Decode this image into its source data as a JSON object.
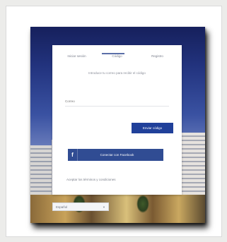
{
  "tabs": [
    {
      "label": "Iniciar sesión"
    },
    {
      "label": "Código"
    },
    {
      "label": "Registro"
    }
  ],
  "active_tab_index": 1,
  "subtitle": "Introduce tu correo para recibir el código",
  "email": {
    "placeholder": "Correo"
  },
  "submit_label": "Enviar código",
  "facebook": {
    "icon": "facebook-icon",
    "label": "Conectar con Facebook"
  },
  "terms_label": "Aceptar los términos y condiciones",
  "language": {
    "selected": "Español"
  },
  "colors": {
    "primary_button": "#20409a",
    "facebook_button": "#304c93",
    "tab_indicator": "#5b6fa8"
  }
}
